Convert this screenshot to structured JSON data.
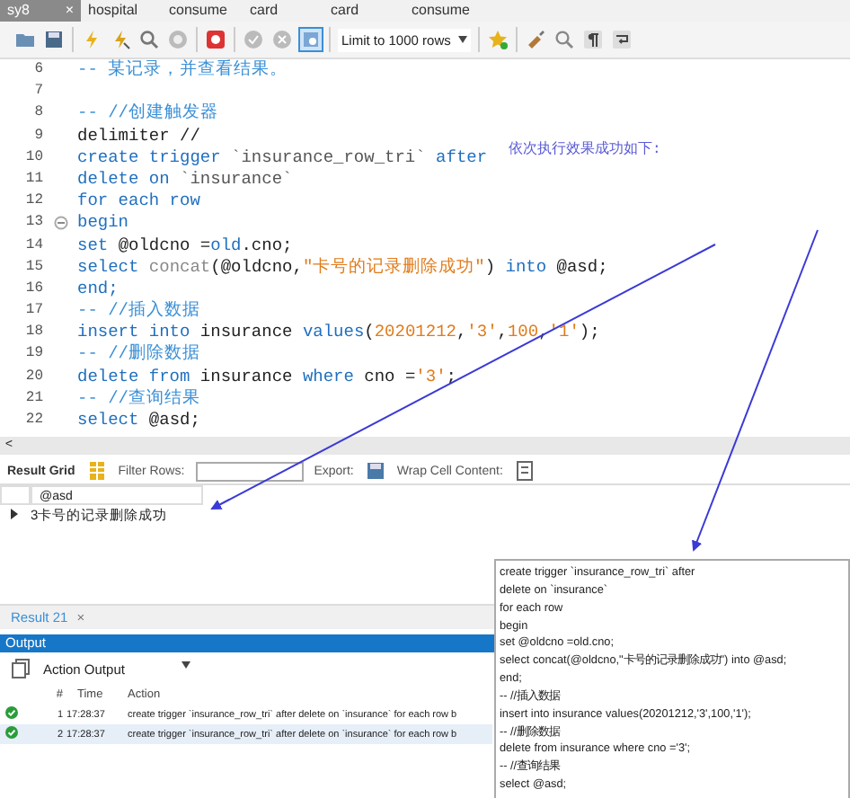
{
  "tabs": [
    {
      "label": "sy8",
      "selected": true,
      "close": "×"
    },
    {
      "label": "hospital",
      "selected": false
    },
    {
      "label": "consume",
      "selected": false
    },
    {
      "label": "card",
      "selected": false
    },
    {
      "label": "card",
      "selected": false
    },
    {
      "label": "consume",
      "selected": false
    }
  ],
  "toolbar": {
    "limit": "Limit to 1000 rows",
    "toggle_selected": true
  },
  "editor": {
    "lines": [
      {
        "num": "6",
        "fold": false,
        "tokens": [
          {
            "t": "-- 某记录，并查看结果。",
            "kind": "comment"
          }
        ]
      },
      {
        "num": "7",
        "fold": false
      },
      {
        "num": "8",
        "fold": false,
        "tokens": [
          {
            "t": "-- //创建触发器",
            "kind": "comment"
          }
        ]
      },
      {
        "num": "9",
        "fold": false,
        "tokens": [
          {
            "t": "delimiter //",
            "kind": "plain"
          }
        ]
      },
      {
        "num": "10",
        "fold": false,
        "tokens": [
          {
            "t": "create trigger ",
            "kind": "keyword"
          },
          {
            "t": "`insurance_row_tri`",
            "kind": "ident"
          },
          {
            "t": " after",
            "kind": "keyword"
          }
        ]
      },
      {
        "num": "11",
        "fold": false,
        "tokens": [
          {
            "t": "delete on ",
            "kind": "keyword"
          },
          {
            "t": "`insurance`",
            "kind": "ident"
          }
        ]
      },
      {
        "num": "12",
        "fold": false,
        "tokens": [
          {
            "t": "for each row",
            "kind": "keyword"
          }
        ]
      },
      {
        "num": "13",
        "fold": true,
        "tokens": [
          {
            "t": "begin",
            "kind": "keyword"
          }
        ]
      },
      {
        "num": "14",
        "fold": false,
        "tokens": [
          {
            "t": "set ",
            "kind": "keyword"
          },
          {
            "t": "@oldcno =",
            "kind": "plain"
          },
          {
            "t": "old",
            "kind": "keyword"
          },
          {
            "t": ".cno;",
            "kind": "plain"
          }
        ]
      },
      {
        "num": "15",
        "fold": false,
        "tokens": [
          {
            "t": "select ",
            "kind": "keyword"
          },
          {
            "t": "concat",
            "kind": "func"
          },
          {
            "t": "(@oldcno,",
            "kind": "plain"
          },
          {
            "t": "\"卡号的记录删除成功\"",
            "kind": "string"
          },
          {
            "t": ") ",
            "kind": "plain"
          },
          {
            "t": "into",
            "kind": "keyword"
          },
          {
            "t": " @asd;",
            "kind": "plain"
          }
        ]
      },
      {
        "num": "16",
        "fold": false,
        "tokens": [
          {
            "t": "end;",
            "kind": "keyword"
          }
        ]
      },
      {
        "num": "17",
        "fold": false,
        "tokens": [
          {
            "t": "-- //插入数据",
            "kind": "comment"
          }
        ]
      },
      {
        "num": "18",
        "fold": false,
        "tokens": [
          {
            "t": "insert into ",
            "kind": "keyword"
          },
          {
            "t": "insurance ",
            "kind": "plain"
          },
          {
            "t": "values",
            "kind": "keyword"
          },
          {
            "t": "(",
            "kind": "plain"
          },
          {
            "t": "20201212",
            "kind": "string"
          },
          {
            "t": ",",
            "kind": "plain"
          },
          {
            "t": "'3'",
            "kind": "string"
          },
          {
            "t": ",",
            "kind": "plain"
          },
          {
            "t": "100",
            "kind": "string"
          },
          {
            "t": ",",
            "kind": "plain"
          },
          {
            "t": "'1'",
            "kind": "string"
          },
          {
            "t": ");",
            "kind": "plain"
          }
        ]
      },
      {
        "num": "19",
        "fold": false,
        "tokens": [
          {
            "t": "-- //删除数据",
            "kind": "comment"
          }
        ]
      },
      {
        "num": "20",
        "fold": false,
        "tokens": [
          {
            "t": "delete from ",
            "kind": "keyword"
          },
          {
            "t": "insurance ",
            "kind": "plain"
          },
          {
            "t": "where ",
            "kind": "keyword"
          },
          {
            "t": "cno =",
            "kind": "plain"
          },
          {
            "t": "'3'",
            "kind": "string"
          },
          {
            "t": ";",
            "kind": "plain"
          }
        ]
      },
      {
        "num": "21",
        "fold": false,
        "tokens": [
          {
            "t": "-- //查询结果",
            "kind": "comment"
          }
        ]
      },
      {
        "num": "22",
        "fold": false,
        "tokens": [
          {
            "t": "select ",
            "kind": "keyword"
          },
          {
            "t": "@asd;",
            "kind": "plain"
          }
        ]
      }
    ],
    "scroll_left": "<"
  },
  "note": "依次执行效果成功如下:",
  "result_toolbar": {
    "grid": "Result Grid",
    "filter": "Filter Rows:",
    "export": "Export:",
    "wrap": "Wrap Cell Content:"
  },
  "result_grid": {
    "columns": [
      "@asd"
    ],
    "rows": [
      [
        "3卡号的记录删除成功"
      ]
    ]
  },
  "result_tab": {
    "label": "Result 21",
    "close": "×"
  },
  "output": {
    "title": "Output",
    "dropdown": "Action Output",
    "columns": [
      "#",
      "Time",
      "Action"
    ],
    "rows": [
      {
        "num": "1",
        "time": "17:28:37",
        "action": "create trigger `insurance_row_tri` after  delete on `insurance` for each row  b",
        "selected": false
      },
      {
        "num": "2",
        "time": "17:28:37",
        "action": "create trigger `insurance_row_tri` after  delete on `insurance` for each row  b",
        "selected": true
      }
    ]
  },
  "tooltip": [
    "create trigger `insurance_row_tri` after",
    "delete on `insurance`",
    "for each row",
    "begin",
    "set @oldcno =old.cno;",
    "select concat(@oldcno,\"卡号的记录删除成功\") into @asd;",
    "end;",
    "-- //插入数据",
    "insert into insurance values(20201212,'3',100,'1');",
    "-- //删除数据",
    "delete from insurance where cno ='3';",
    "-- //查询结果",
    "select @asd;"
  ]
}
